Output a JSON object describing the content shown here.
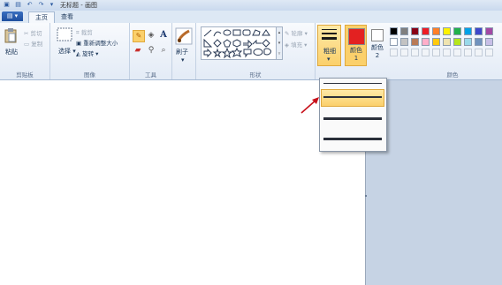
{
  "window": {
    "title": "无标题 - 画图"
  },
  "tabs": [
    {
      "label": "主页"
    },
    {
      "label": "查看"
    }
  ],
  "file_button": {
    "label": ""
  },
  "clipboard": {
    "paste": "粘贴",
    "cut": "剪切",
    "copy": "复制",
    "group": "剪贴板"
  },
  "image": {
    "select": "选择",
    "crop": "裁剪",
    "resize": "重新调整大小",
    "rotate": "旋转",
    "group": "图像"
  },
  "tools": {
    "group": "工具"
  },
  "brushes": {
    "label": "刷子"
  },
  "shapes": {
    "outline": "轮廓",
    "fill": "填充",
    "group": "形状"
  },
  "size": {
    "label": "粗细"
  },
  "colors": {
    "color1": "颜色 1",
    "color2": "颜色 2",
    "group": "颜色",
    "color1_value": "#e32121",
    "color2_value": "#ffffff",
    "palette_row1": [
      "#000000",
      "#7f7f7f",
      "#880015",
      "#ed1c24",
      "#ff7f27",
      "#fff200",
      "#22b14c",
      "#00a2e8",
      "#3f48cc",
      "#a349a4"
    ],
    "palette_row2": [
      "#ffffff",
      "#c3c3c3",
      "#b97a57",
      "#ffaec9",
      "#ffc90e",
      "#efe4b0",
      "#b5e61d",
      "#99d9ea",
      "#7092be",
      "#c8bfe7"
    ]
  },
  "size_dropdown": {
    "selected_index": 1
  }
}
